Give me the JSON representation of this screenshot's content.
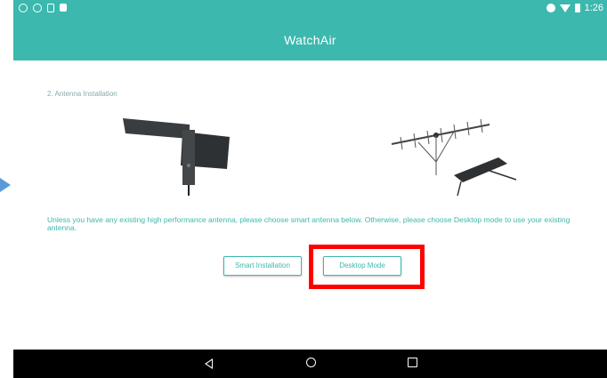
{
  "app": {
    "title": "WatchAir"
  },
  "status_bar": {
    "time": "1:26"
  },
  "section": {
    "title": "2. Antenna Installation"
  },
  "description": "Unless you have any existing high performance antenna, please choose smart antenna below. Otherwise, please choose Desktop mode to use your existing antenna.",
  "buttons": {
    "smart": "Smart Installation",
    "desktop": "Desktop Mode"
  },
  "icons": {
    "smart_antenna": "flat-antenna-image",
    "desktop_antenna": "yagi-antenna-image",
    "nav_back": "back-icon",
    "nav_home": "home-icon",
    "nav_recent": "recent-apps-icon"
  },
  "colors": {
    "accent": "#3cb8ae",
    "highlight": "#ff0000",
    "pointer": "#5b9bd5"
  }
}
